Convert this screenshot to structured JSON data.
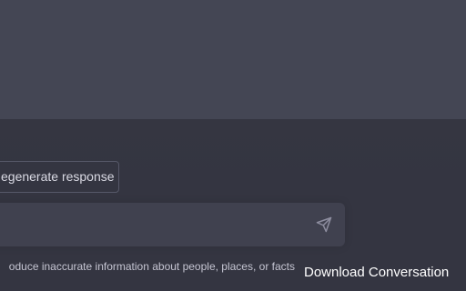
{
  "chat": {
    "regenerate_label": "egenerate response",
    "input_placeholder": "",
    "disclaimer": "oduce inaccurate information about people, places, or facts",
    "send_icon": "paper-plane-icon"
  },
  "extension": {
    "download_label": "Download Conversation"
  },
  "colors": {
    "message_bg": "#444654",
    "page_bg": "#343541",
    "input_bg": "#40414f",
    "border": "#565869",
    "text": "#d9d9e3"
  }
}
